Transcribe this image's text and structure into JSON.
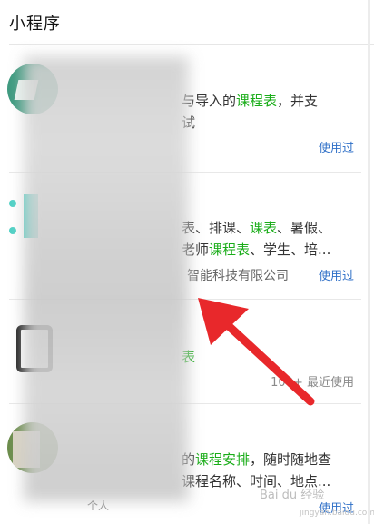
{
  "header": {
    "title": "小程序"
  },
  "results": [
    {
      "desc_lines": [
        [
          "与导入的",
          {
            "hl": "课程表"
          },
          "，并支"
        ],
        [
          "试"
        ]
      ],
      "used_label": "使用过"
    },
    {
      "desc_lines": [
        [
          "表、排课、",
          {
            "hl": "课表"
          },
          "、暑假、"
        ],
        [
          "老师",
          {
            "hl": "课程表"
          },
          "、学生、培..."
        ]
      ],
      "company": "智能科技有限公司",
      "used_label": "使用过"
    },
    {
      "desc_lines": [
        [
          "表"
        ]
      ],
      "meta_label": "100+ 最近使用"
    },
    {
      "desc_lines": [
        [
          "的",
          {
            "hl": "课程安排"
          },
          "，随时随地查"
        ],
        [
          "课程名称、时间、地点..."
        ]
      ],
      "used_label": "使用过"
    }
  ],
  "watermark": {
    "text": "Bai du 经验",
    "sub": "jingyan.baidu.com"
  },
  "bottom_hint": "个人"
}
